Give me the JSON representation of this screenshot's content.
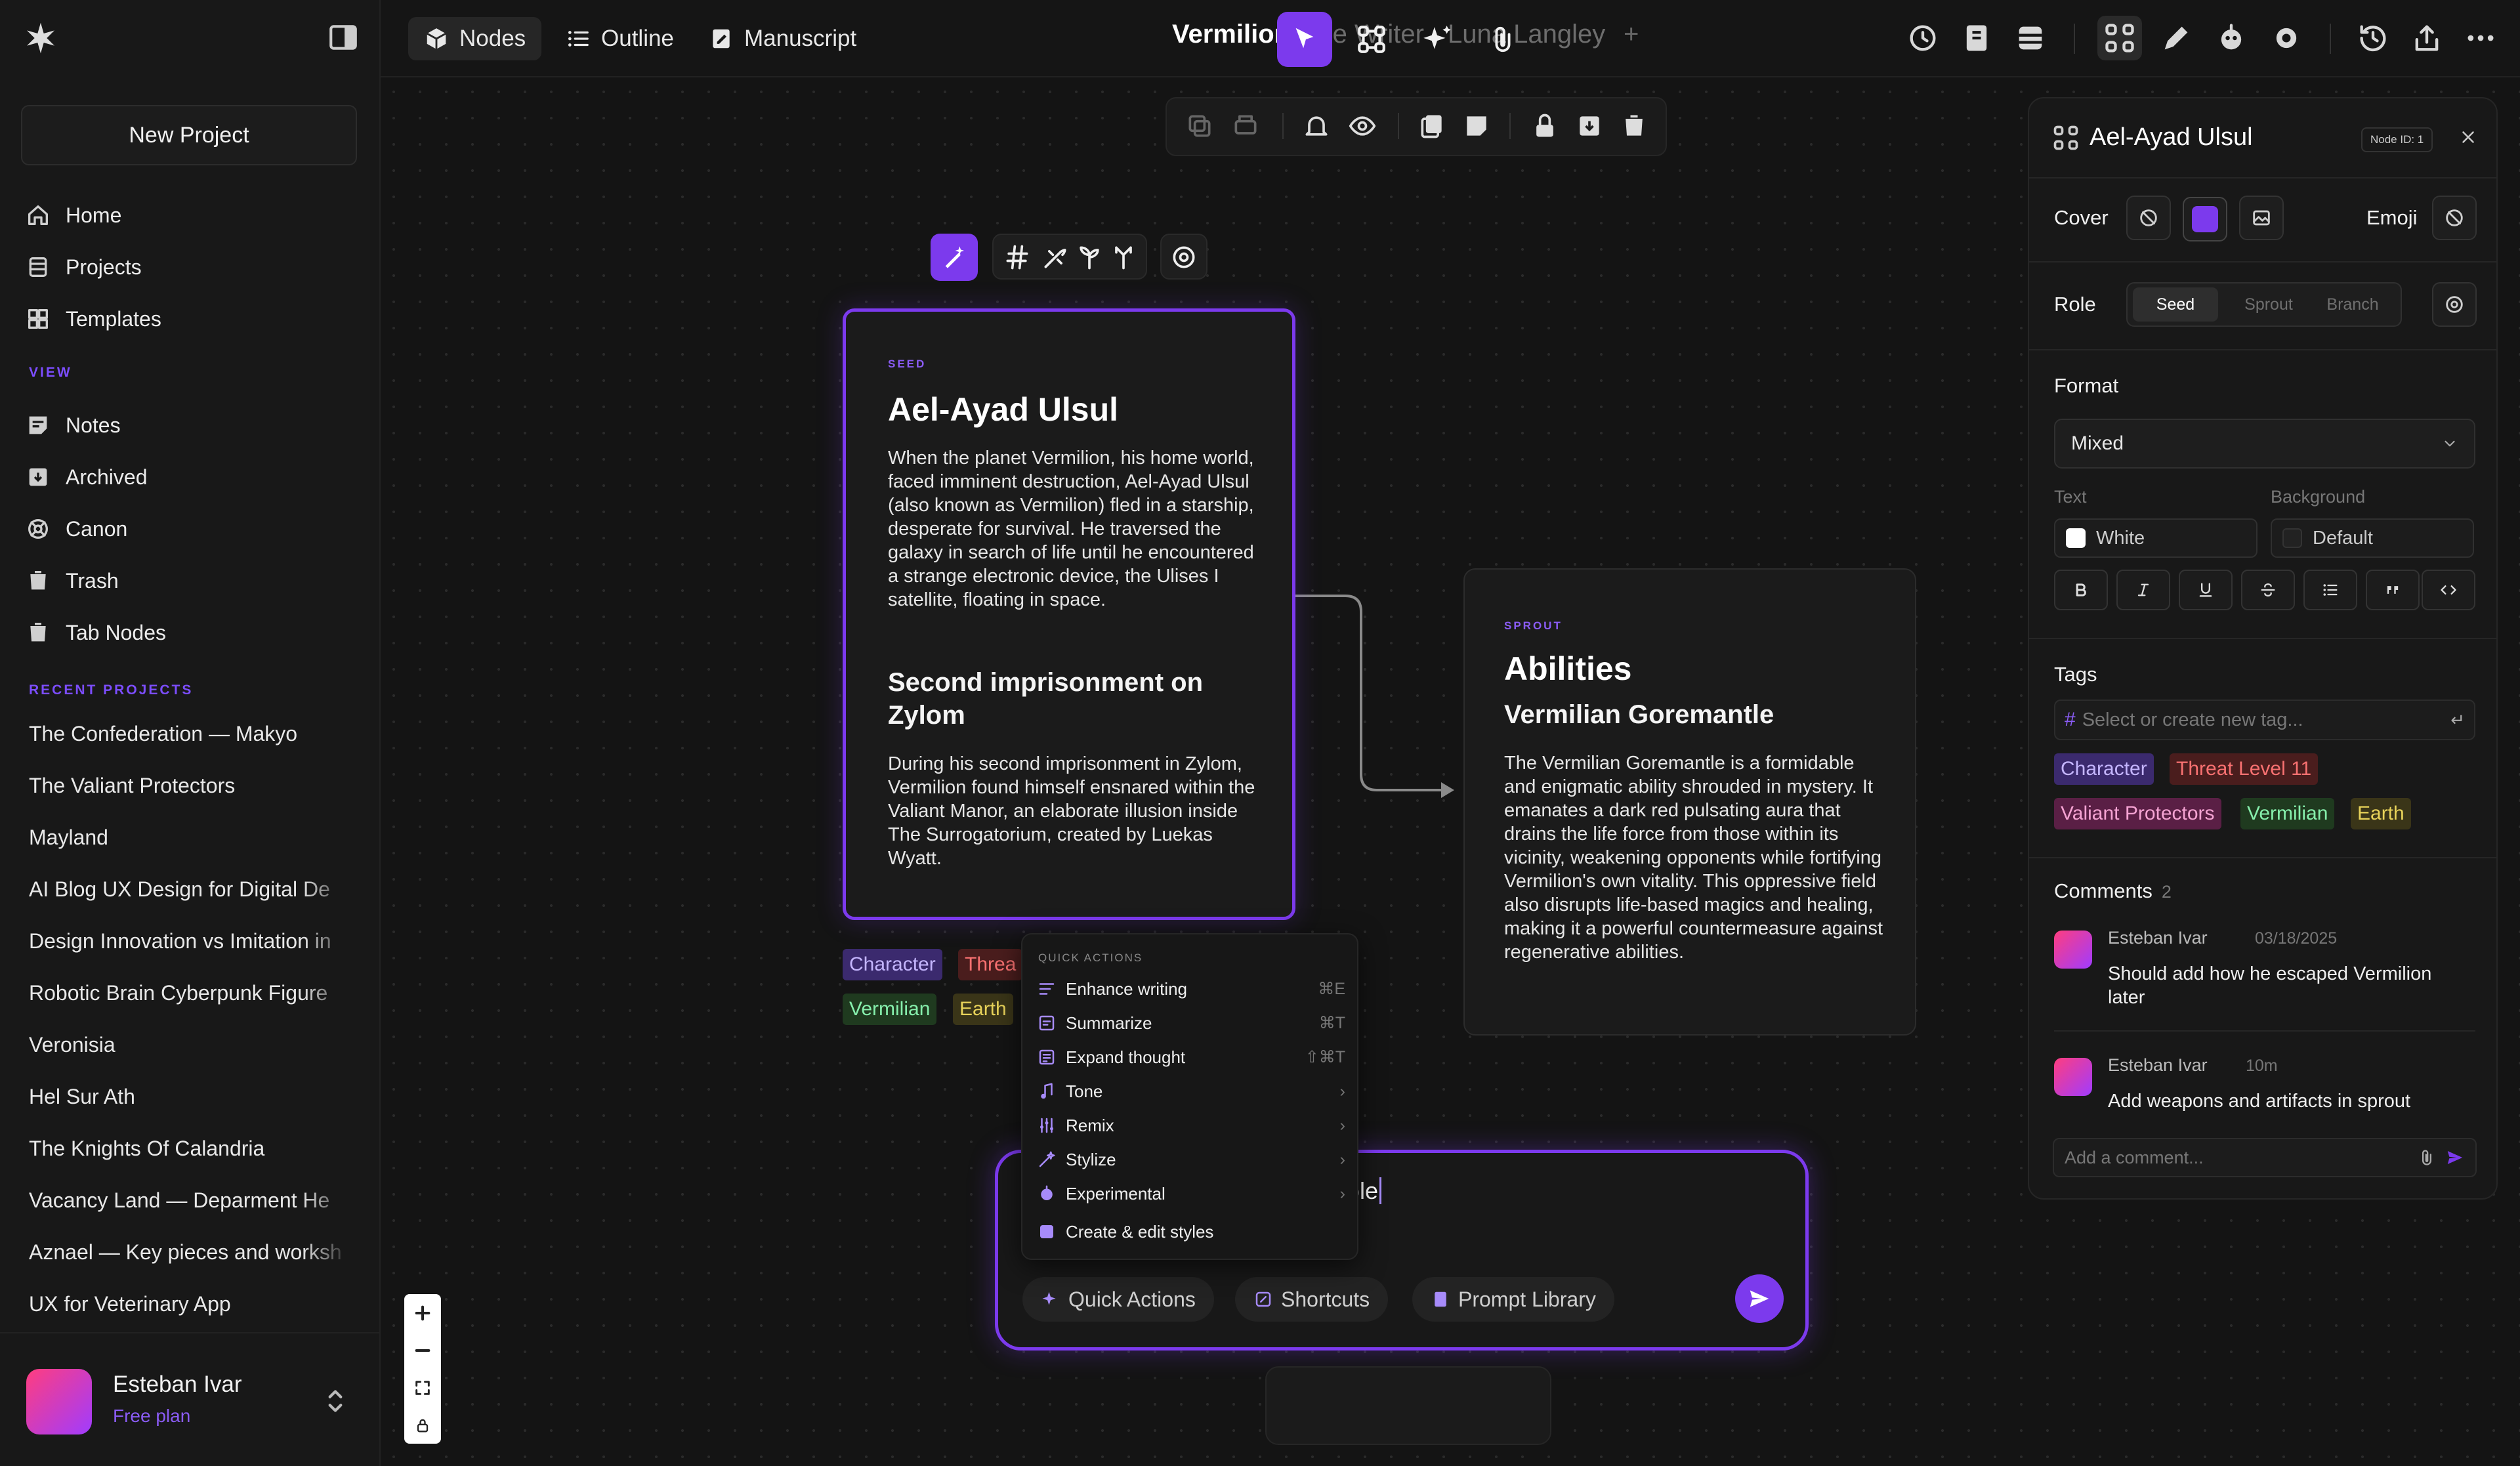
{
  "sidebar": {
    "new_project": "New Project",
    "nav": [
      {
        "label": "Home",
        "icon": "home-icon"
      },
      {
        "label": "Projects",
        "icon": "projects-icon"
      },
      {
        "label": "Templates",
        "icon": "templates-icon"
      }
    ],
    "view_label": "VIEW",
    "view_items": [
      {
        "label": "Notes",
        "icon": "notes-icon"
      },
      {
        "label": "Archived",
        "icon": "archive-icon"
      },
      {
        "label": "Canon",
        "icon": "canon-icon"
      },
      {
        "label": "Trash",
        "icon": "trash-icon"
      },
      {
        "label": "Tab Nodes",
        "icon": "trash-icon"
      }
    ],
    "recent_label": "RECENT PROJECTS",
    "recent": [
      "The Confederation — Makyo",
      "The Valiant Protectors",
      "Mayland",
      "AI Blog UX Design for Digital De",
      "Design Innovation vs Imitation in",
      "Robotic Brain Cyberpunk Figure",
      "Veronisia",
      "Hel Sur Ath",
      "The Knights Of Calandria",
      "Vacancy Land — Deparment He",
      "Aznael — Key pieces and worksh",
      "UX for Veterinary App"
    ],
    "user": {
      "name": "Esteban Ivar",
      "plan": "Free plan"
    }
  },
  "topbar": {
    "tabs": [
      {
        "label": "Nodes",
        "icon": "cube-icon",
        "active": true
      },
      {
        "label": "Outline",
        "icon": "list-icon",
        "active": false
      },
      {
        "label": "Manuscript",
        "icon": "manuscript-icon",
        "active": false
      }
    ],
    "projects": [
      "Vermilion",
      "The Writer",
      "Luna Langley"
    ],
    "add": "+"
  },
  "cards": {
    "seed": {
      "eyebrow": "SEED",
      "title": "Ael-Ayad Ulsul",
      "body1": "When the planet Vermilion, his home world, faced imminent destruction, Ael-Ayad Ulsul (also known as Vermilion) fled in a starship, desperate for survival. He traversed the galaxy in search of life until he encountered a strange electronic device, the Ulises I satellite, floating in space.",
      "heading2": "Second imprisonment on Zylom",
      "body2": "During his second imprisonment in Zylom, Vermilion found himself ensnared within the Valiant Manor, an elaborate illusion inside The Surrogatorium, created by Luekas Wyatt."
    },
    "sprout": {
      "eyebrow": "SPROUT",
      "title": "Abilities",
      "subtitle": "Vermilian Goremantle",
      "body": "The Vermilian Goremantle is a formidable and enigmatic ability shrouded in mystery. It emanates a dark red pulsating aura that drains the life force from those within its vicinity, weakening opponents while fortifying Vermilion's own vitality. This oppressive field also disrupts life-based magics and healing, making it a powerful countermeasure against regenerative abilities."
    },
    "seed_tags": [
      "Character",
      "Threa",
      "Vermilian",
      "Earth"
    ]
  },
  "quick_actions": {
    "label": "QUICK ACTIONS",
    "items": [
      {
        "label": "Enhance writing",
        "shortcut": "⌘E",
        "icon": "enhance-icon"
      },
      {
        "label": "Summarize",
        "shortcut": "⌘T",
        "icon": "summarize-icon"
      },
      {
        "label": "Expand thought",
        "shortcut": "⇧⌘T",
        "icon": "expand-icon"
      },
      {
        "label": "Tone",
        "shortcut": "›",
        "icon": "tone-icon"
      },
      {
        "label": "Remix",
        "shortcut": "›",
        "icon": "remix-icon"
      },
      {
        "label": "Stylize",
        "shortcut": "›",
        "icon": "stylize-icon"
      },
      {
        "label": "Experimental",
        "shortcut": "›",
        "icon": "experimental-icon"
      },
      {
        "label": "Create & edit styles",
        "shortcut": "",
        "icon": "styles-icon"
      }
    ]
  },
  "prompt": {
    "text": "ole",
    "chips": [
      "Quick Actions",
      "Shortcuts",
      "Prompt Library"
    ]
  },
  "panel": {
    "title": "Ael-Ayad Ulsul",
    "node_id": "Node ID: 1",
    "cover_label": "Cover",
    "emoji_label": "Emoji",
    "role_label": "Role",
    "roles": [
      "Seed",
      "Sprout",
      "Branch"
    ],
    "format_label": "Format",
    "format_value": "Mixed",
    "text_label": "Text",
    "text_value": "White",
    "bg_label": "Background",
    "bg_value": "Default",
    "tags_label": "Tags",
    "tags_placeholder": "Select or create new tag...",
    "tags": [
      "Character",
      "Threat Level 11",
      "Valiant Protectors",
      "Vermilian",
      "Earth"
    ],
    "comments_label": "Comments",
    "comments_count": "2",
    "comments": [
      {
        "author": "Esteban Ivar",
        "time": "03/18/2025",
        "text": "Should add how he escaped Vermilion later"
      },
      {
        "author": "Esteban Ivar",
        "time": "10m",
        "text": "Add weapons and artifacts in sprout"
      }
    ],
    "comment_placeholder": "Add a comment..."
  },
  "colors": {
    "accent": "#7c3aed",
    "bg": "#141414"
  }
}
